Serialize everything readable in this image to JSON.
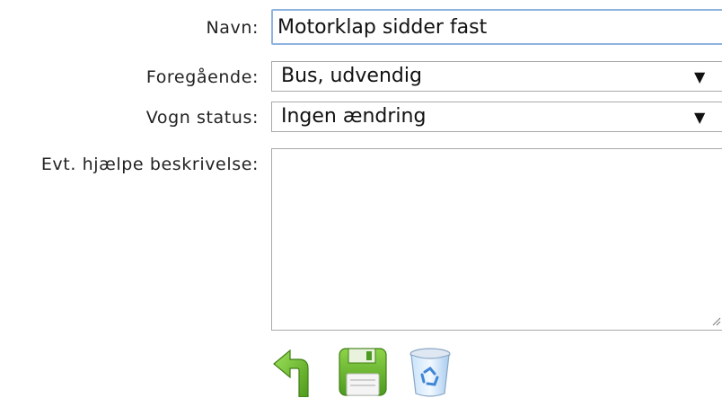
{
  "form": {
    "name_label": "Navn:",
    "name_value": "Motorklap sidder fast",
    "previous_label": "Foregående:",
    "previous_value": "Bus, udvendig",
    "status_label": "Vogn status:",
    "status_value": "Ingen ændring",
    "help_label": "Evt. hjælpe beskrivelse:",
    "help_value": ""
  },
  "actions": {
    "icons": [
      "back-arrow-icon",
      "save-disk-icon",
      "recycle-bin-icon"
    ]
  },
  "colors": {
    "green": "#6bbf2e",
    "focus_border": "#8fb3e0",
    "bin_blue": "#6aa8e6"
  }
}
